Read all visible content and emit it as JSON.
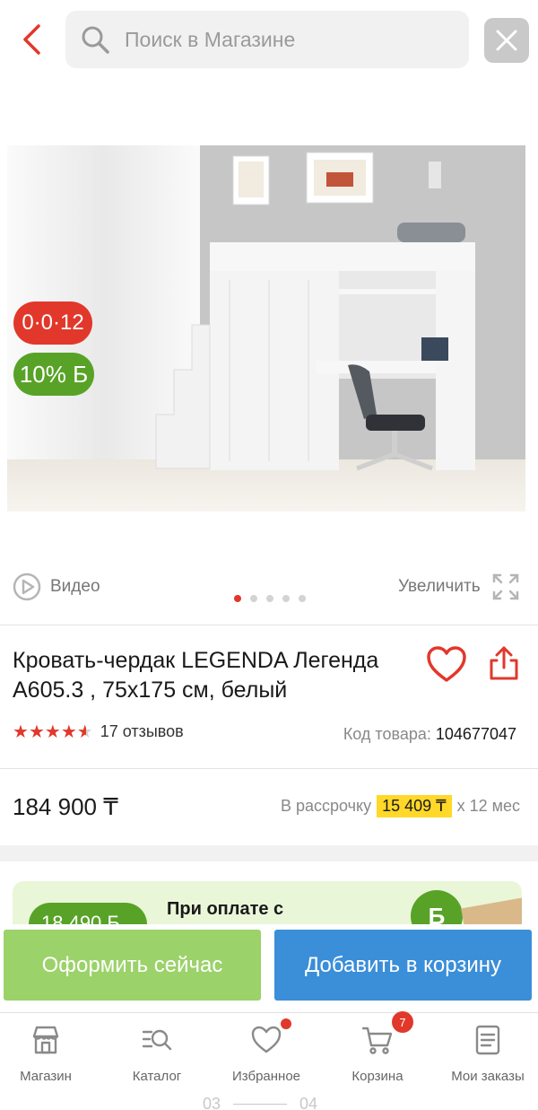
{
  "header": {
    "search_placeholder": "Поиск в Магазине"
  },
  "gallery": {
    "badge_installment": "0·0·12",
    "badge_bonus": "10% Б",
    "video_label": "Видео",
    "zoom_label": "Увеличить",
    "slide_count": 5,
    "active_slide": 1
  },
  "product": {
    "title": "Кровать-чердак LEGENDA Легенда A605.3 , 75x175 см, белый",
    "rating": 4.5,
    "reviews_label": "17 отзывов",
    "code_label": "Код товара:",
    "code_value": "104677047",
    "price": "184 900 ₸",
    "installment_prefix": "В рассрочку",
    "installment_amount": "15 409 ₸",
    "installment_suffix": "x 12 мес"
  },
  "promo": {
    "pill_text": "18 490 Б",
    "text": "При оплате с",
    "logo_letter": "Б"
  },
  "actions": {
    "order_label": "Оформить сейчас",
    "cart_label": "Добавить в корзину"
  },
  "nav": {
    "items": [
      {
        "label": "Магазин",
        "icon": "store-icon"
      },
      {
        "label": "Каталог",
        "icon": "catalog-search-icon"
      },
      {
        "label": "Избранное",
        "icon": "heart-icon"
      },
      {
        "label": "Корзина",
        "icon": "cart-icon"
      },
      {
        "label": "Мои заказы",
        "icon": "orders-icon"
      }
    ],
    "cart_count": "7"
  },
  "pager": {
    "left": "03",
    "right": "04"
  },
  "colors": {
    "accent_red": "#e1382b",
    "bonus_green": "#58a327",
    "order_green": "#9bd26a",
    "cart_blue": "#3b8ed8",
    "installment_yellow": "#ffd829"
  }
}
